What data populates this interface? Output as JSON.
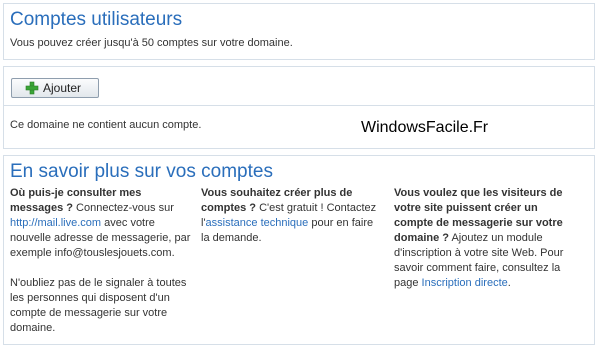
{
  "accounts": {
    "title": "Comptes utilisateurs",
    "subtitle": "Vous pouvez créer jusqu'à 50 comptes sur votre domaine."
  },
  "toolbar": {
    "add_label": "Ajouter",
    "add_icon": "plus-icon",
    "empty_message": "Ce domaine ne contient aucun compte."
  },
  "watermark": "WindowsFacile.Fr",
  "learn": {
    "title": "En savoir plus sur vos comptes",
    "col1": {
      "question": "Où puis-je consulter mes messages ?",
      "text1": " Connectez-vous sur ",
      "link": "http://mail.live.com",
      "text2": " avec votre nouvelle adresse de messagerie, par exemple info@touslesjouets.com.",
      "note": "N'oubliez pas de le signaler à toutes les personnes qui disposent d'un compte de messagerie sur votre domaine."
    },
    "col2": {
      "question": "Vous souhaitez créer plus de comptes ?",
      "text1": " C'est gratuit ! Contactez l'",
      "link": "assistance technique",
      "text2": " pour en faire la demande."
    },
    "col3": {
      "question": "Vous voulez que les visiteurs de votre site puissent créer un compte de messagerie sur votre domaine ?",
      "text1": " Ajoutez un module d'inscription à votre site Web. Pour savoir comment faire, consultez la page ",
      "link": "Inscription directe",
      "text2": "."
    }
  },
  "colors": {
    "accent": "#2a6ebb",
    "border": "#d6dfe8",
    "plus_green": "#3aa536"
  }
}
